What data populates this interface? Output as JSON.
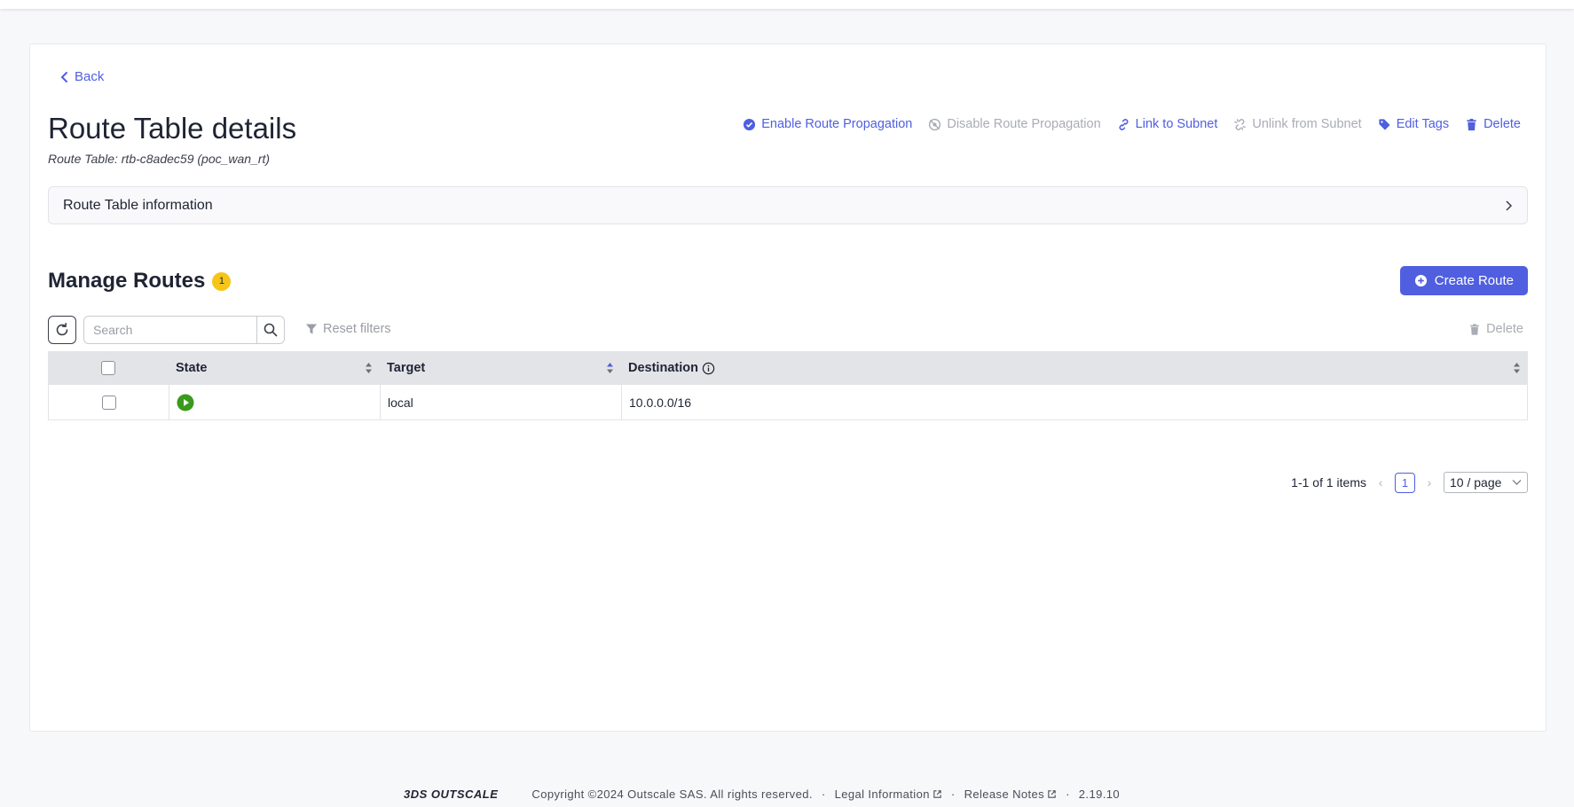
{
  "page": {
    "back_label": "Back",
    "title": "Route Table details",
    "subtitle": "Route Table: rtb-c8adec59 (poc_wan_rt)"
  },
  "actions": [
    {
      "label": "Enable Route Propagation",
      "icon": "check-circle-icon",
      "enabled": true
    },
    {
      "label": "Disable Route Propagation",
      "icon": "eye-slash-icon",
      "enabled": false
    },
    {
      "label": "Link to Subnet",
      "icon": "link-icon",
      "enabled": true
    },
    {
      "label": "Unlink from Subnet",
      "icon": "unlink-icon",
      "enabled": false
    },
    {
      "label": "Edit Tags",
      "icon": "tag-icon",
      "enabled": true
    },
    {
      "label": "Delete",
      "icon": "trash-icon",
      "enabled": true
    }
  ],
  "accordion": {
    "label": "Route Table information"
  },
  "routes": {
    "title": "Manage Routes",
    "count": "1",
    "create_label": "Create Route",
    "search_placeholder": "Search",
    "reset_filters_label": "Reset filters",
    "delete_label": "Delete",
    "columns": [
      "State",
      "Target",
      "Destination"
    ],
    "rows": [
      {
        "state": "running",
        "target": "local",
        "destination": "10.0.0.0/16"
      }
    ],
    "pagination": {
      "summary": "1-1 of 1 items",
      "current_page": "1",
      "page_size": "10 / page"
    }
  },
  "footer": {
    "logo": "3DS OUTSCALE",
    "copyright": "Copyright ©2024 Outscale SAS. All rights reserved.",
    "legal_label": "Legal Information",
    "release_label": "Release Notes",
    "version": "2.19.10"
  },
  "colors": {
    "accent": "#4f5fe0",
    "badge": "#f5c518",
    "state_running": "#3a9a1c",
    "disabled": "#a9acb4"
  }
}
